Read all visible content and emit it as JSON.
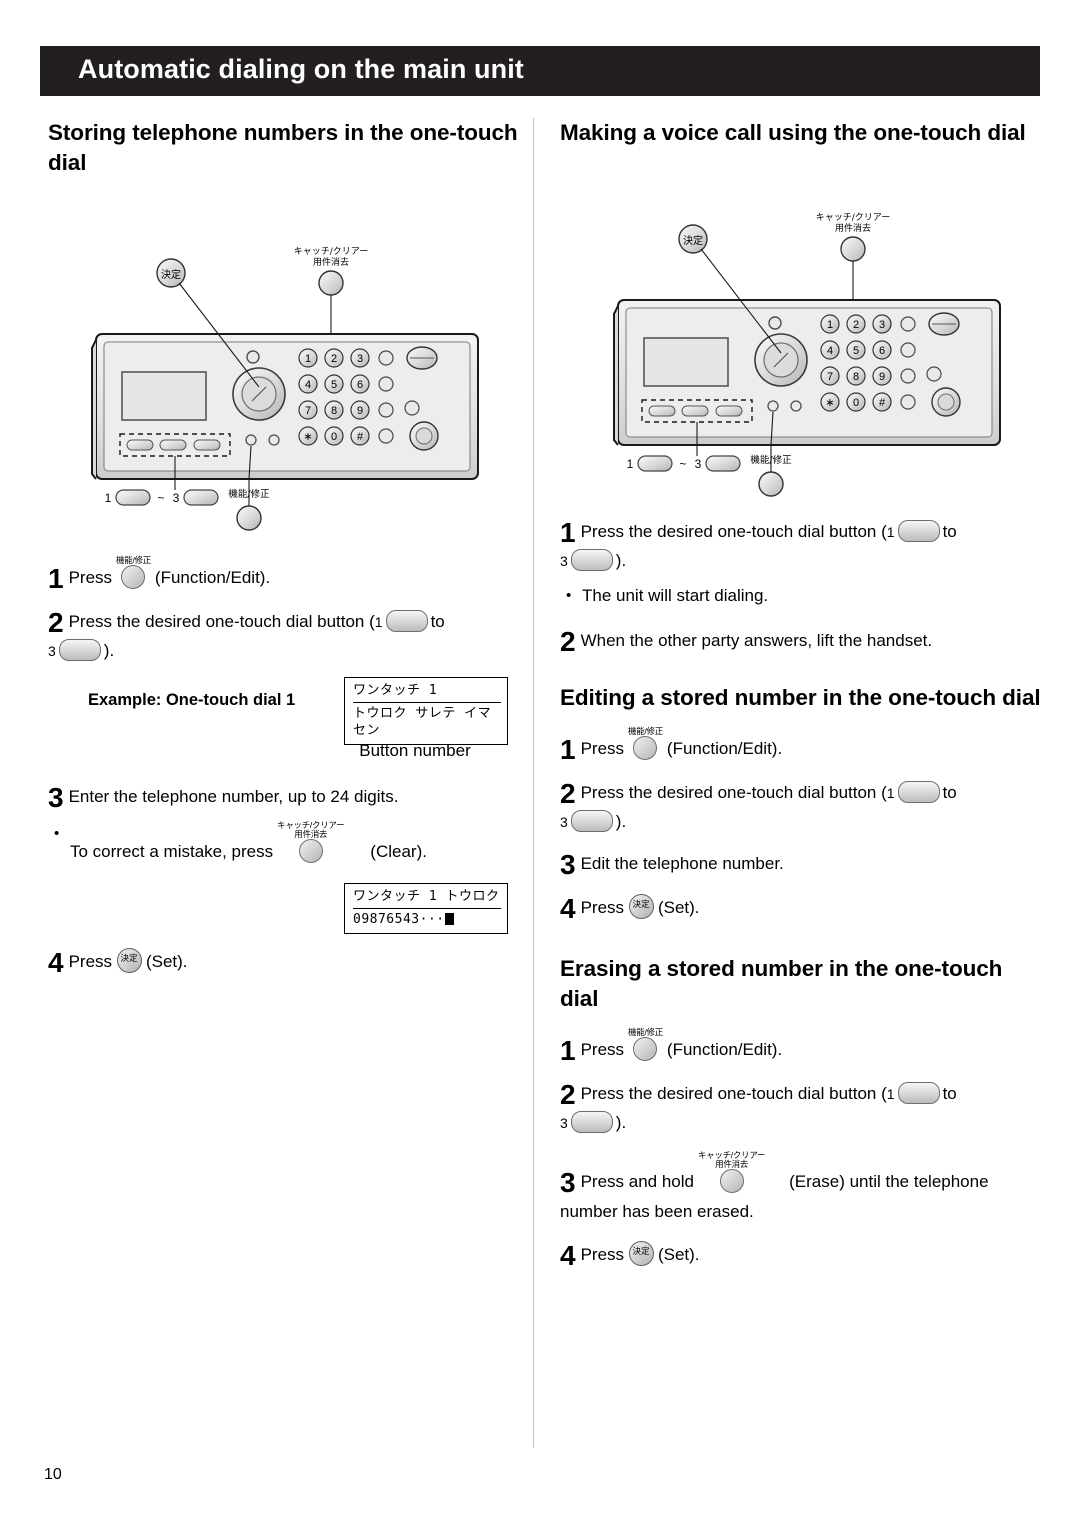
{
  "page": {
    "title": "Automatic dialing on the main unit",
    "number": "10"
  },
  "left": {
    "heading": "Storing telephone numbers in the one-touch dial",
    "steps": [
      {
        "num": "1",
        "pre": "Press",
        "key_top": "機能/修正",
        "post": "(Function/Edit)."
      },
      {
        "num": "2",
        "pre": "Press the desired one-touch dial button (",
        "mid": "1",
        "mid2": "to",
        "mid3": "3",
        "post": ")."
      },
      {
        "num": "3",
        "text": "Enter the telephone number, up to 24 digits."
      },
      {
        "num": "4",
        "pre": "Press",
        "key_label": "決定",
        "post": "(Set)."
      }
    ],
    "example_label": "Example: One-touch dial 1",
    "example_lcd_line1": "ワンタッチ 1",
    "example_lcd_line2": "トウロク サレテ イマセン",
    "button_number_caption": "Button number",
    "bullet_correct_pre": "To correct a mistake, press",
    "bullet_correct_key": "キャッチ/クリアー",
    "bullet_correct_key2": "用件消去",
    "bullet_correct_post": "(Clear).",
    "lcd2_line1": "ワンタッチ 1  トウロク",
    "lcd2_line2": "09876543···"
  },
  "right": {
    "heading_voice": "Making a voice call using the one-touch dial",
    "voice_steps": [
      {
        "num": "1",
        "pre": "Press the desired one-touch dial button (",
        "mid": "1",
        "mid2": "to",
        "mid3": "3",
        "post": ")."
      },
      {
        "num": "2",
        "text": "When the other party answers, lift the handset."
      }
    ],
    "voice_bullet": "The unit will start dialing.",
    "heading_edit": "Editing a stored number in the one-touch dial",
    "edit_steps": [
      {
        "num": "1",
        "pre": "Press",
        "key_top": "機能/修正",
        "post": "(Function/Edit)."
      },
      {
        "num": "2",
        "pre": "Press the desired one-touch dial button (",
        "mid": "1",
        "mid2": "to",
        "mid3": "3",
        "post": ")."
      },
      {
        "num": "3",
        "text": "Edit the telephone number."
      },
      {
        "num": "4",
        "pre": "Press",
        "key_label": "決定",
        "post": "(Set)."
      }
    ],
    "heading_erase": "Erasing a stored number in the one-touch dial",
    "erase_steps": [
      {
        "num": "1",
        "pre": "Press",
        "key_top": "機能/修正",
        "post": "(Function/Edit)."
      },
      {
        "num": "2",
        "pre": "Press the desired one-touch dial button (",
        "mid": "1",
        "mid2": "to",
        "mid3": "3",
        "post": ")."
      },
      {
        "num": "3",
        "pre": "Press and hold",
        "key_top1": "キャッチ/クリアー",
        "key_top2": "用件消去",
        "post": "(Erase) until the telephone number has been erased."
      },
      {
        "num": "4",
        "pre": "Press",
        "key_label": "決定",
        "post": "(Set)."
      }
    ]
  },
  "device": {
    "set_key_label": "決定",
    "clear_key_label_1": "キャッチ/クリアー",
    "clear_key_label_2": "用件消去",
    "function_key_label": "機能/修正",
    "onetouch_from": "1",
    "onetouch_tilde": "~",
    "onetouch_to": "3",
    "keypad": [
      "1",
      "2",
      "3",
      "4",
      "5",
      "6",
      "7",
      "8",
      "9",
      "∗",
      "0",
      "#"
    ]
  }
}
